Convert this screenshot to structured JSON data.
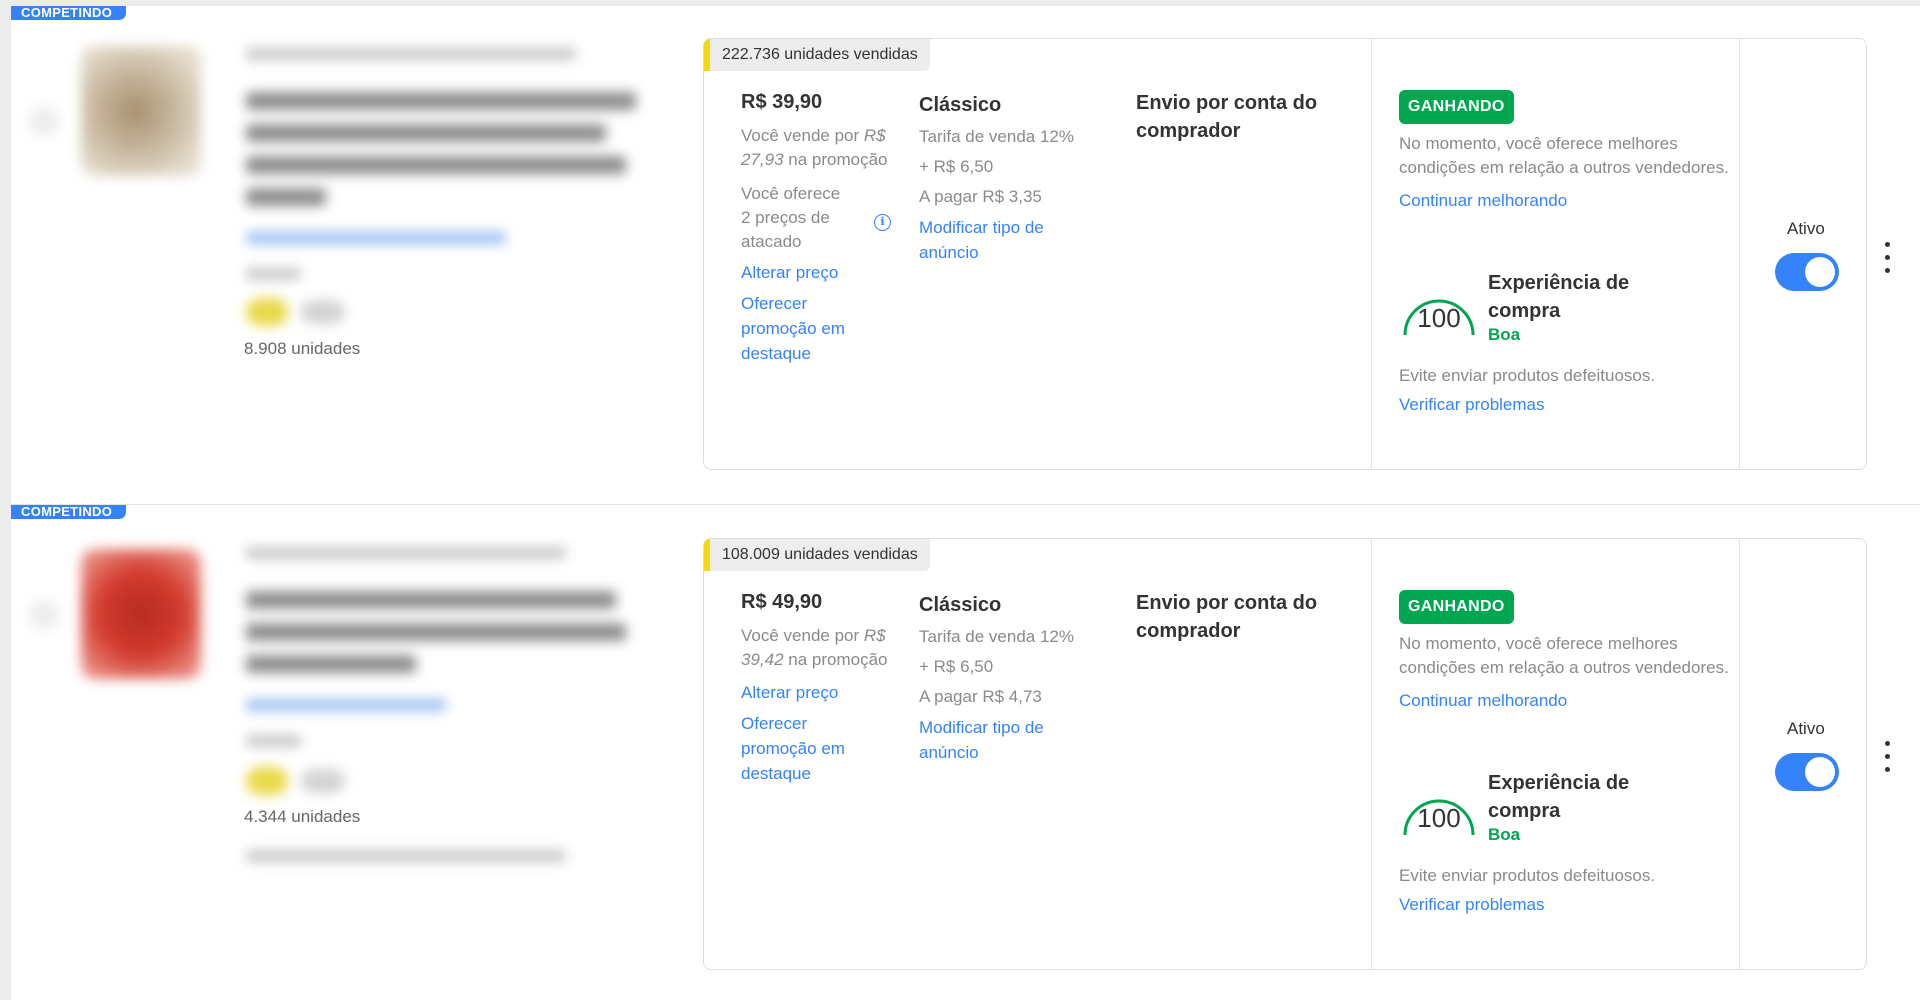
{
  "listings": [
    {
      "badge": "COMPETINDO",
      "units_label": "8.908 unidades",
      "sold_label": "222.736 unidades vendidas",
      "price": "R$ 39,90",
      "sell_for_prefix": "Você vende por",
      "promo_price": "R$ 27,93",
      "sell_for_suffix": "na promoção",
      "wholesale_note": "Você oferece 2 preços de atacado",
      "change_price": "Alterar preço",
      "offer_promo": "Oferecer promoção em destaque",
      "listing_type": "Clássico",
      "fee_line1": "Tarifa de venda 12%",
      "fee_line2": "+ R$ 6,50",
      "to_pay": "A pagar R$ 3,35",
      "modify_type": "Modificar tipo de anúncio",
      "shipping": "Envio por conta do comprador",
      "status_badge": "GANHANDO",
      "status_text": "No momento, você oferece melhores condições em relação a outros vendedores.",
      "keep_improving": "Continuar melhorando",
      "gauge_value": "100",
      "experience_title": "Experiência de compra",
      "experience_rating": "Boa",
      "avoid_text": "Evite enviar produtos defeituosos.",
      "check_problems": "Verificar problemas",
      "active_label": "Ativo",
      "active": true
    },
    {
      "badge": "COMPETINDO",
      "units_label": "4.344 unidades",
      "sold_label": "108.009 unidades vendidas",
      "price": "R$ 49,90",
      "sell_for_prefix": "Você vende por",
      "promo_price": "R$ 39,42",
      "sell_for_suffix": "na promoção",
      "change_price": "Alterar preço",
      "offer_promo": "Oferecer promoção em destaque",
      "listing_type": "Clássico",
      "fee_line1": "Tarifa de venda 12%",
      "fee_line2": "+ R$ 6,50",
      "to_pay": "A pagar R$ 4,73",
      "modify_type": "Modificar tipo de anúncio",
      "shipping": "Envio por conta do comprador",
      "status_badge": "GANHANDO",
      "status_text": "No momento, você oferece melhores condições em relação a outros vendedores.",
      "keep_improving": "Continuar melhorando",
      "gauge_value": "100",
      "experience_title": "Experiência de compra",
      "experience_rating": "Boa",
      "avoid_text": "Evite enviar produtos defeituosos.",
      "check_problems": "Verificar problemas",
      "active_label": "Ativo",
      "active": true
    }
  ],
  "colors": {
    "accent": "#3483fa",
    "success": "#00a650",
    "highlight": "#f5d90a"
  }
}
